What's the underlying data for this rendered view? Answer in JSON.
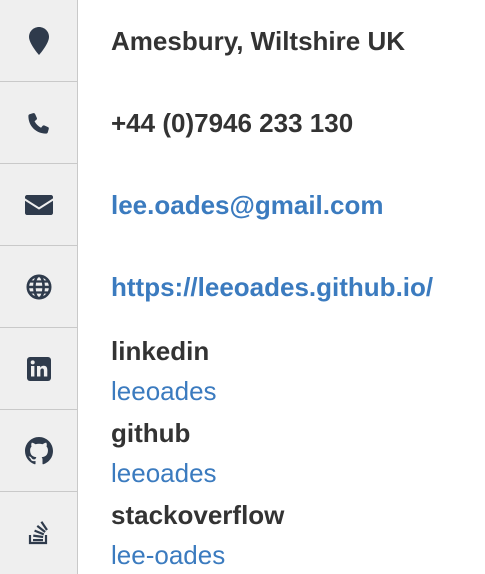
{
  "contact": {
    "location": "Amesbury, Wiltshire UK",
    "phone": "+44 (0)7946 233 130",
    "email": "lee.oades@gmail.com",
    "website": "https://leeoades.github.io/"
  },
  "profiles": [
    {
      "network": "linkedin",
      "username": "leeoades",
      "icon": "linkedin-icon"
    },
    {
      "network": "github",
      "username": "leeoades",
      "icon": "github-icon"
    },
    {
      "network": "stackoverflow",
      "username": "lee-oades",
      "icon": "stackoverflow-icon"
    }
  ],
  "icons": {
    "location": "map-marker-icon",
    "phone": "phone-icon",
    "email": "envelope-icon",
    "website": "globe-icon"
  },
  "colors": {
    "text": "#333333",
    "link": "#3b7bbf",
    "icon": "#2f3b4c",
    "icon_bg": "#efefef",
    "border": "#c9c9c9"
  }
}
